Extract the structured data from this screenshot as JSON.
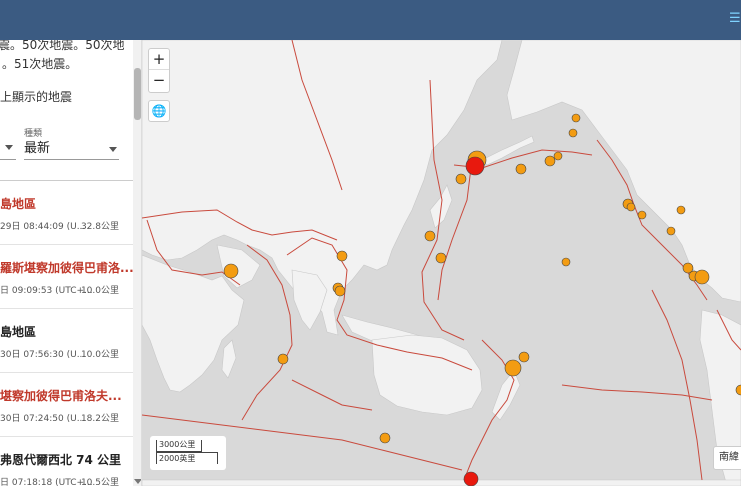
{
  "summary": {
    "line1": "震。50次地震。50次地",
    "line2": "。51次地震。"
  },
  "map_filter_label": "上顯示的地震",
  "sort": {
    "label": "種類",
    "value": "最新"
  },
  "quakes": [
    {
      "title": "島地區",
      "time": "29日 08:44:09 (U...",
      "depth": "32.8公里",
      "color": "red"
    },
    {
      "title": "羅斯堪察加彼得巴甫洛...",
      "time": "日 09:09:53 (UTC+...",
      "depth": "10.0公里",
      "color": "red"
    },
    {
      "title": "島地區",
      "time": "30日 07:56:30 (U...",
      "depth": "10.0公里",
      "color": "dark"
    },
    {
      "title": "堪察加彼得巴甫洛夫...",
      "time": "30日 07:24:50 (U...",
      "depth": "18.2公里",
      "color": "red"
    },
    {
      "title": "弗恩代爾西北 74 公里",
      "time": "日 07:18:18 (UTC+...",
      "depth": "10.5公里",
      "color": "dark"
    }
  ],
  "map_controls": {
    "zoom_in": "+",
    "zoom_out": "−",
    "globe": "🌐"
  },
  "scale": {
    "km": "3000公里",
    "mi": "2000英里"
  },
  "legend_button": "南緯",
  "colors": {
    "header": "#3b5b82",
    "quake_small": "#f39c12",
    "quake_large": "#e8190e",
    "plate_boundary": "#c0392b",
    "land": "#f2f2f2",
    "water": "#d9d9d9"
  }
}
